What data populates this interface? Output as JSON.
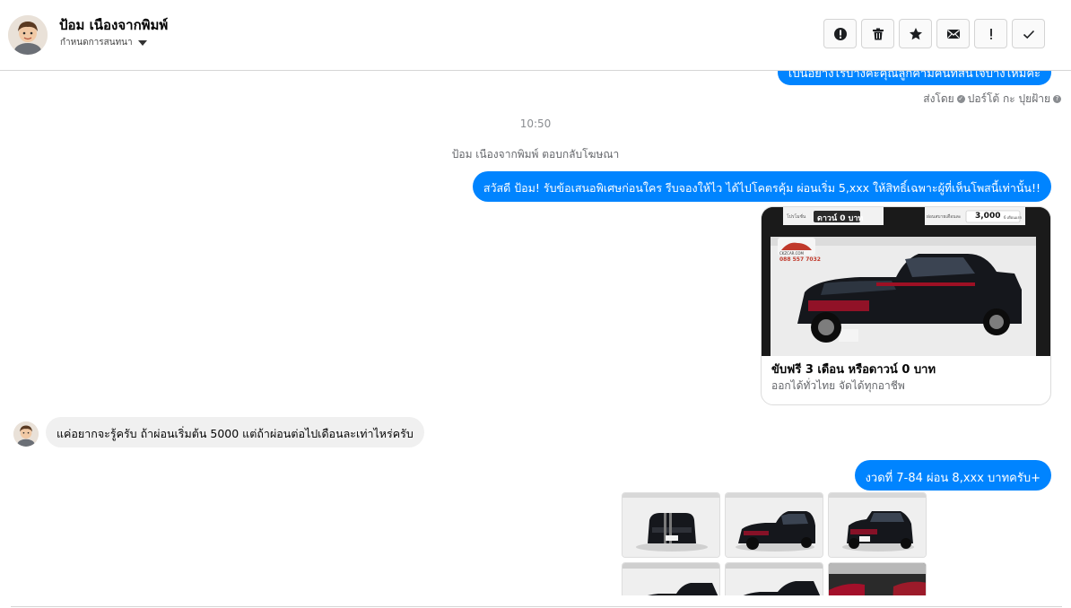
{
  "header": {
    "contact_name": "ป้อม เนืองจากพิมพ์",
    "subline_label": "กำหนดการสนทนา",
    "toolbar": [
      {
        "name": "alert-icon"
      },
      {
        "name": "trash-icon"
      },
      {
        "name": "star-icon"
      },
      {
        "name": "mail-icon"
      },
      {
        "name": "exclamation-icon"
      },
      {
        "name": "check-icon"
      }
    ]
  },
  "chat": {
    "prev_bubble_text": "เป็นอย่างไรบ้างคะคุณลูกค้ามีคนที่สนใจบ้างไหมคะ",
    "sent_by_prefix": "ส่งโดย",
    "sent_by_name": "ปอร์โต้ กะ ปุยฝ้าย",
    "timestamp": "10:50",
    "system_line": "ป้อม เนืองจากพิมพ์ ตอบกลับโฆษณา",
    "msg_offer": "สวัสดี ป้อม! รับข้อเสนอพิเศษก่อนใคร รีบจองให้ไว ได้ไปโคตรคุ้ม ผ่อนเริ่ม 5,xxx  ให้สิทธิ์เฉพาะผู้ที่เห็นโพสนี้เท่านั้น!!",
    "ad": {
      "banner_left": "ดาวน์ 0 บาท",
      "banner_left_small": "โปรโมชั่น",
      "banner_right": "3,000",
      "banner_right_small": "ผ่อนสบายเดือนละ",
      "banner_right_unit": "6 เดือนแรก",
      "logo_text": "CKZCAR.COM",
      "phone": "088 557 7032",
      "title": "ขับฟรี 3 เดือน หรือดาวน์ 0 บาท",
      "description": "ออกได้ทั่วไทย จัดได้ทุกอาชีพ"
    },
    "msg_customer": "แค่อยากจะรู้ครับ  ถ้าผ่อนเริ่มต้น 5000 แต่ถ้าผ่อนต่อไปเดือนละเท่าไหร่ครับ",
    "msg_installment": "งวดที่ 7-84 ผ่อน 8,xxx บาทครับ+"
  },
  "colors": {
    "accent": "#0084ff",
    "incoming": "#f0f0f0"
  }
}
